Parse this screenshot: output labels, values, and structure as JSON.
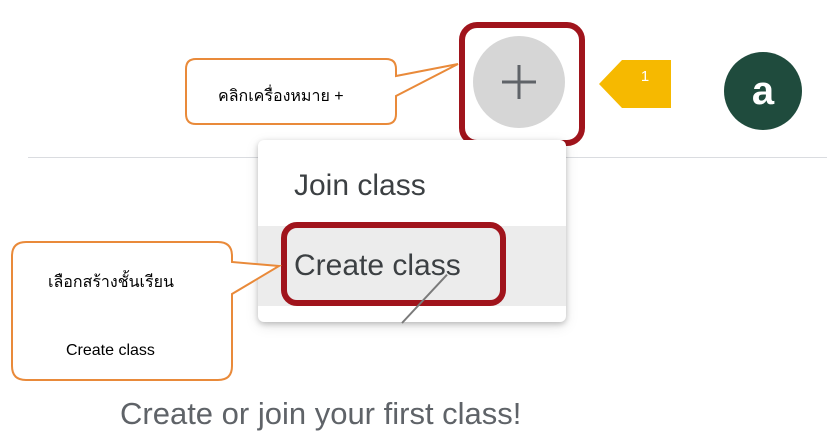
{
  "header": {
    "add_button_symbol": "+",
    "avatar_initial": "a"
  },
  "menu": {
    "items": [
      {
        "label": "Join class"
      },
      {
        "label": "Create class"
      }
    ]
  },
  "main": {
    "empty_state_text": "Create or join your first class!"
  },
  "annotations": {
    "step_number": "1",
    "callout_add": "คลิกเครื่องหมาย +",
    "callout_create_title": "เลือกสร้างชั้นเรียน",
    "callout_create_sub": "Create class"
  },
  "colors": {
    "highlight_frame": "#a0141c",
    "callout_border": "#e98a3a",
    "step_marker": "#f6b900",
    "avatar_bg": "#1f4b3d",
    "add_button_bg": "#d6d6d6"
  },
  "icons": {
    "add": "plus-icon"
  }
}
